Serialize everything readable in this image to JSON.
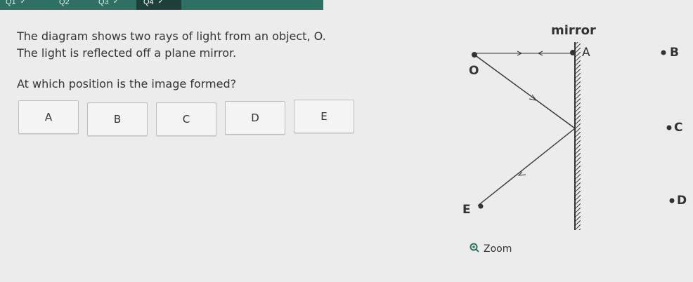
{
  "tabs": [
    {
      "label": "Q1",
      "check": "✓"
    },
    {
      "label": "Q2",
      "check": ""
    },
    {
      "label": "Q3",
      "check": "✓"
    },
    {
      "label": "Q4",
      "check": "✓"
    },
    {
      "label": "",
      "check": ""
    },
    {
      "label": "",
      "check": ""
    }
  ],
  "question": {
    "line1": "The diagram shows two rays of light from an object, O.",
    "line2": "The light is reflected off a plane mirror.",
    "prompt": "At which position is the image formed?"
  },
  "options": [
    "A",
    "B",
    "C",
    "D",
    "E"
  ],
  "diagram": {
    "mirror_label": "mirror",
    "labels": {
      "O": "O",
      "A": "A",
      "B": "B",
      "C": "C",
      "D": "D",
      "E": "E"
    }
  },
  "zoom": {
    "label": "Zoom",
    "icon": "zoom-in-icon"
  },
  "colors": {
    "accent": "#2f6f64",
    "accent_dark": "#1f3f3a"
  }
}
